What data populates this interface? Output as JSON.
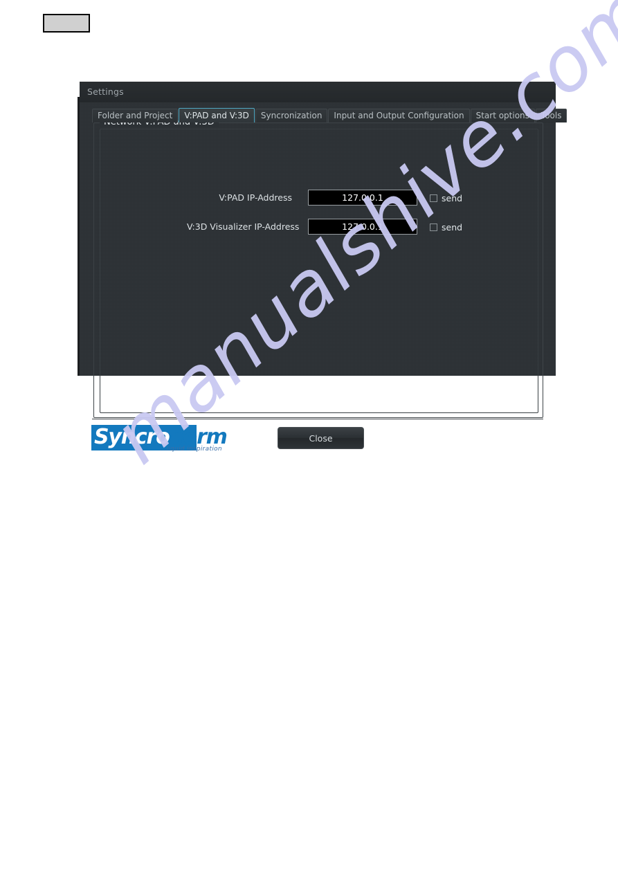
{
  "window": {
    "title": "Settings"
  },
  "tabs": [
    {
      "label": "Folder and Project",
      "active": false
    },
    {
      "label": "V:PAD and V:3D",
      "active": true
    },
    {
      "label": "Syncronization",
      "active": false
    },
    {
      "label": "Input and Output Configuration",
      "active": false
    },
    {
      "label": "Start options",
      "active": false
    },
    {
      "label": "Tools",
      "active": false
    }
  ],
  "groupbox": {
    "title": "Network  V:PAD and V:3D"
  },
  "fields": {
    "vpad": {
      "label": "V:PAD IP-Address",
      "value": "127.0.0.1",
      "placeholder": "127.0.0.1",
      "send_label": "send",
      "send_checked": false
    },
    "v3d": {
      "label": "V:3D Visualizer IP-Address",
      "value": "127.0.0.1",
      "placeholder": "127.0.0.1",
      "send_label": "send",
      "send_checked": false
    }
  },
  "footer": {
    "logo": {
      "part1": "Syncro",
      "part2": "norm",
      "tagline": "...liquid inspiration",
      "brand_color": "#1379be"
    },
    "close_label": "Close"
  },
  "watermark": {
    "text": "manualshive.com",
    "color": "#c9c9f2"
  },
  "colors": {
    "dialog_bg": "#2c3135",
    "accent_tab": "#4fa9c4",
    "input_bg": "#000000",
    "text": "#d5d9db"
  }
}
